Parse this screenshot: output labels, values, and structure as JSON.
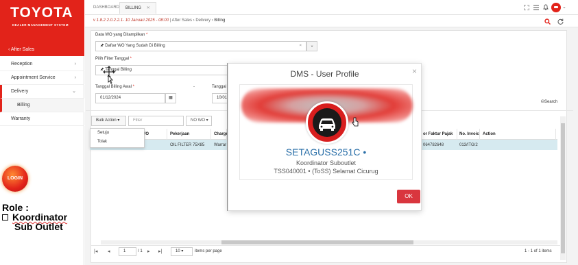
{
  "brand": {
    "logo": "TOYOTA",
    "subtitle": "DEALER MANAGEMENT SYSTEM",
    "back_label": "After Sales"
  },
  "sidebar": {
    "items": [
      {
        "label": "Reception",
        "chevron": "›"
      },
      {
        "label": "Appointment Service",
        "chevron": "›"
      },
      {
        "label": "Delivery",
        "chevron": "⌄"
      },
      {
        "label": "Billing",
        "chevron": ""
      },
      {
        "label": "Warranty",
        "chevron": ""
      }
    ]
  },
  "login_badge": "LOGIN",
  "role_note": {
    "heading": "Role :",
    "line1": "Koordinator",
    "line2": "Sub Outlet"
  },
  "tabs": [
    {
      "label": "DASHBOARD"
    },
    {
      "label": "BILLING"
    }
  ],
  "breadcrumb": {
    "version": "v 1.8.2 2.0.2.2.1- 10 Januari 2025 - 08:00",
    "path": "| After Sales  ›  Delivery  ›  ",
    "current": "Billing"
  },
  "form": {
    "wo_label": "Data WO yang Ditampilkan",
    "wo_value": "Daftar WO Yang Sudah Di Billing",
    "filter_label": "Pilih Filter Tanggal",
    "filter_value": "Tanggal Billing",
    "start_label": "Tanggal Billing Awal",
    "start_value": "01/12/2024",
    "dash": "-",
    "end_label": "Tanggal",
    "end_value": "10/01",
    "search_label": "Search",
    "required_mark": "*"
  },
  "toolbar": {
    "bulk_label": "Bulk Action",
    "filter_placeholder": "Filter",
    "nowo_label": "NO WO"
  },
  "bulk_menu": [
    "Setuju",
    "Tolak"
  ],
  "table": {
    "headers": [
      "ri WO",
      "Pekerjaan",
      "Charge",
      "or Faktur Pajak ...",
      "No. Invoic",
      "Action"
    ],
    "row": [
      "",
      "OIL FILTER 75X85",
      "Warrar",
      "064782648",
      "013/ITG/2",
      ""
    ]
  },
  "pagination": {
    "page": "1",
    "of_pages": "/ 1",
    "per_page": "10",
    "per_page_label": "items per page",
    "summary": "1 - 1 of 1 items"
  },
  "modal": {
    "title": "DMS - User Profile",
    "close": "×",
    "username": "SETAGUSS251C •",
    "role": "Koordinator Suboutlet",
    "outlet": "TSS040001 • (ToSS) Selamat Cicurug",
    "ok_label": "OK"
  },
  "colors": {
    "brand_red": "#e2231a",
    "link_blue": "#2a6fa8",
    "ok_red": "#d9363e"
  }
}
